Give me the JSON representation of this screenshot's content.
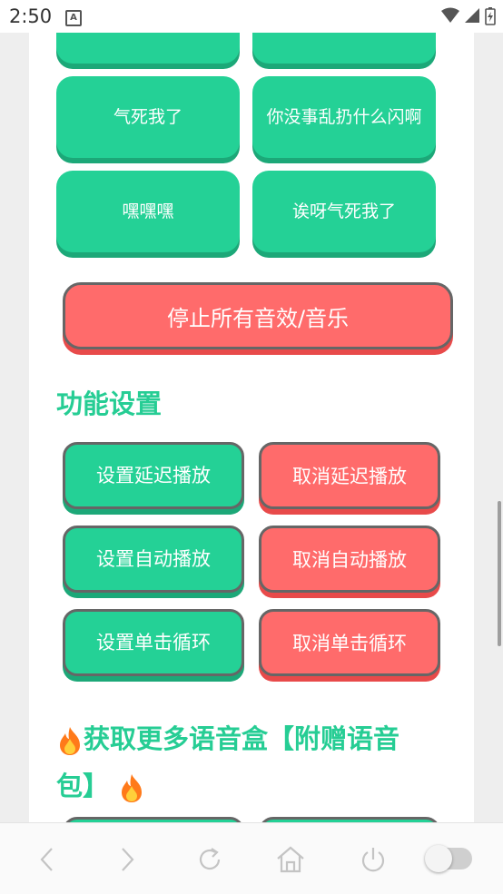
{
  "status_bar": {
    "time": "2:50",
    "notification_icon": "A"
  },
  "sound_buttons": [
    {
      "label": ""
    },
    {
      "label": ""
    },
    {
      "label": "气死我了"
    },
    {
      "label": "你没事乱扔什么闪啊"
    },
    {
      "label": "嘿嘿嘿"
    },
    {
      "label": "诶呀气死我了"
    }
  ],
  "stop_button": {
    "label": "停止所有音效/音乐"
  },
  "settings": {
    "title": "功能设置",
    "buttons": [
      {
        "label": "设置延迟播放",
        "color": "#24d196"
      },
      {
        "label": "取消延迟播放",
        "color": "#ff6b6b"
      },
      {
        "label": "设置自动播放",
        "color": "#24d196"
      },
      {
        "label": "取消自动播放",
        "color": "#ff6b6b"
      },
      {
        "label": "设置单击循环",
        "color": "#24d196"
      },
      {
        "label": "取消单击循环",
        "color": "#ff6b6b"
      }
    ]
  },
  "more_section": {
    "title_line1": "获取更多语音盒【附赠语音",
    "title_line2": "包】"
  },
  "colors": {
    "accent_green": "#24d196",
    "accent_red": "#ff6b6b",
    "title_green": "#26cd94"
  },
  "bottom_nav": {
    "icons": [
      "back-icon",
      "forward-icon",
      "refresh-icon",
      "home-icon",
      "power-icon"
    ],
    "toggle_on": false
  }
}
